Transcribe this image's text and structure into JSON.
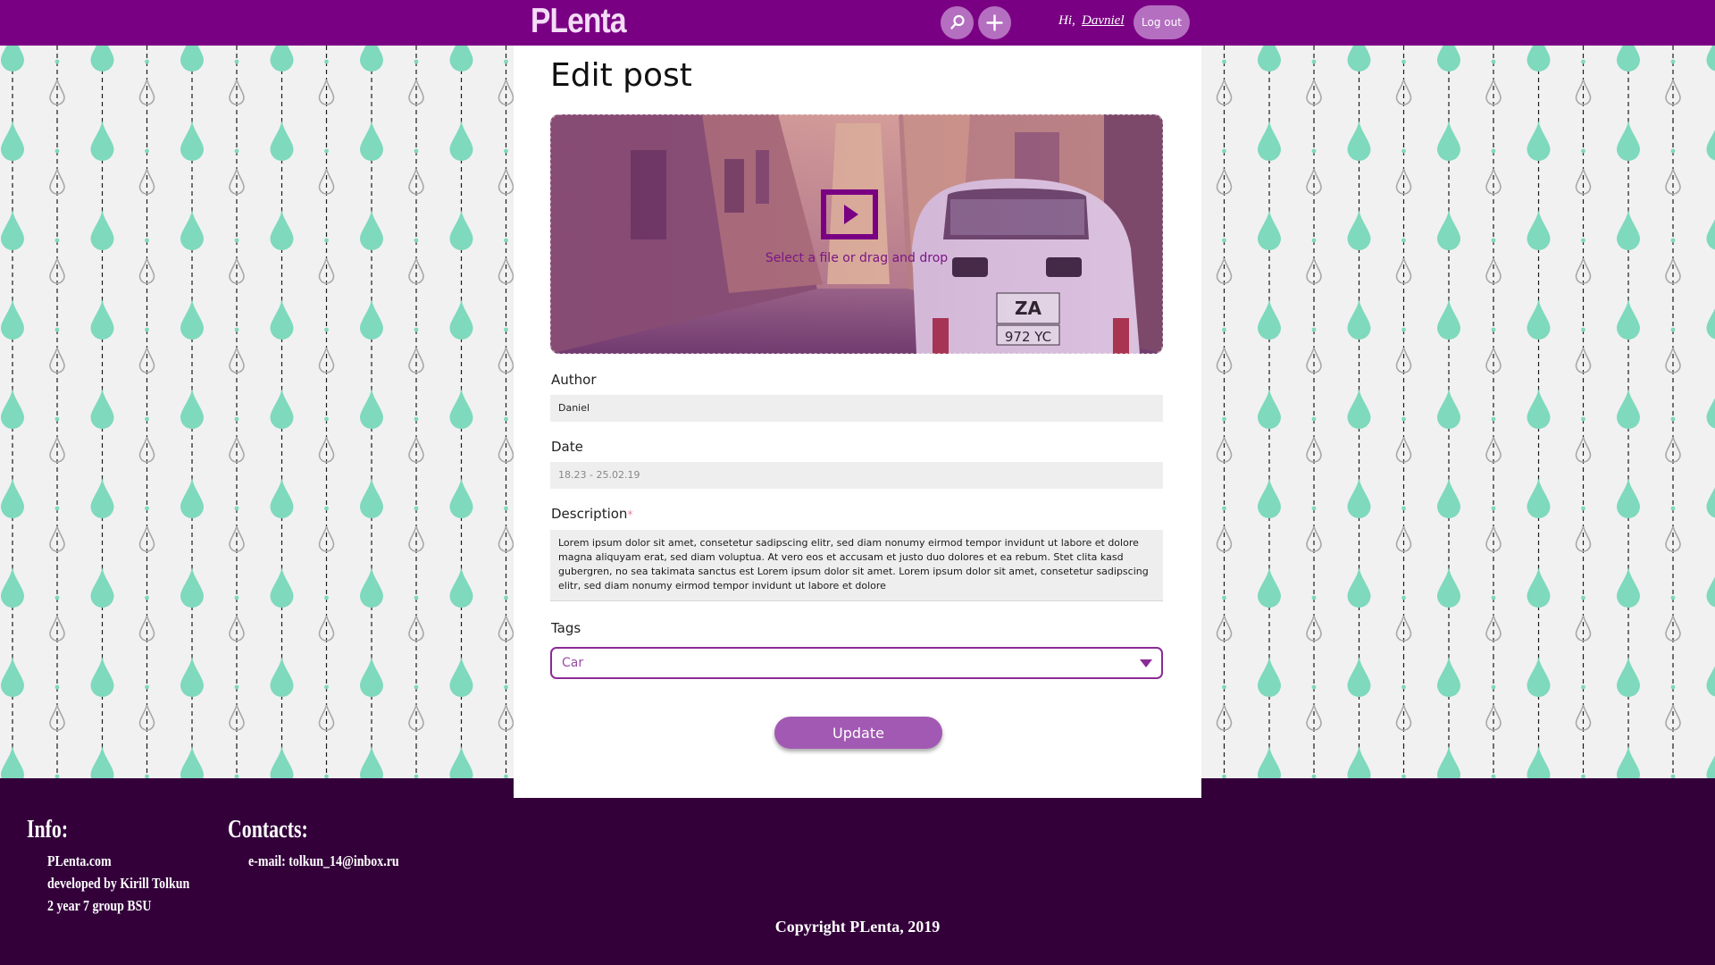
{
  "header": {
    "logo": "PLenta",
    "greeting": "Hi,",
    "username": "Davniel",
    "logout_label": "Log out",
    "search_icon": "search-icon",
    "add_icon": "plus-icon"
  },
  "form": {
    "title": "Edit post",
    "upload": {
      "text": "Select a file or drag and drop",
      "icon": "video-play-icon"
    },
    "author": {
      "label": "Author",
      "value": "Daniel"
    },
    "date": {
      "label": "Date",
      "value": "18.23 - 25.02.19"
    },
    "description": {
      "label": "Description",
      "required_mark": "*",
      "value": "Lorem ipsum dolor sit amet, consetetur sadipscing elitr, sed diam nonumy eirmod tempor invidunt ut labore et dolore magna aliquyam erat, sed diam voluptua. At vero eos et accusam et justo duo dolores et ea rebum. Stet clita kasd gubergren, no sea takimata sanctus est Lorem ipsum dolor sit amet. Lorem ipsum dolor sit amet, consetetur sadipscing elitr, sed diam nonumy eirmod tempor invidunt ut labore et dolore"
    },
    "tags": {
      "label": "Tags",
      "selected": "Car"
    },
    "submit_label": "Update"
  },
  "footer": {
    "info_title": "Info:",
    "info_lines": [
      "PLenta.com",
      "developed by Kirill Tolkun",
      "2 year 7 group BSU"
    ],
    "contacts_title": "Contacts:",
    "contact_email": "e-mail: tolkun_14@inbox.ru",
    "copyright": "Copyright PLenta, 2019"
  },
  "colors": {
    "header_bg": "#7a0083",
    "footer_bg": "#33003a",
    "accent": "#a259b3",
    "drop_color": "#7ed9bd",
    "background": "#f1f1f1"
  }
}
